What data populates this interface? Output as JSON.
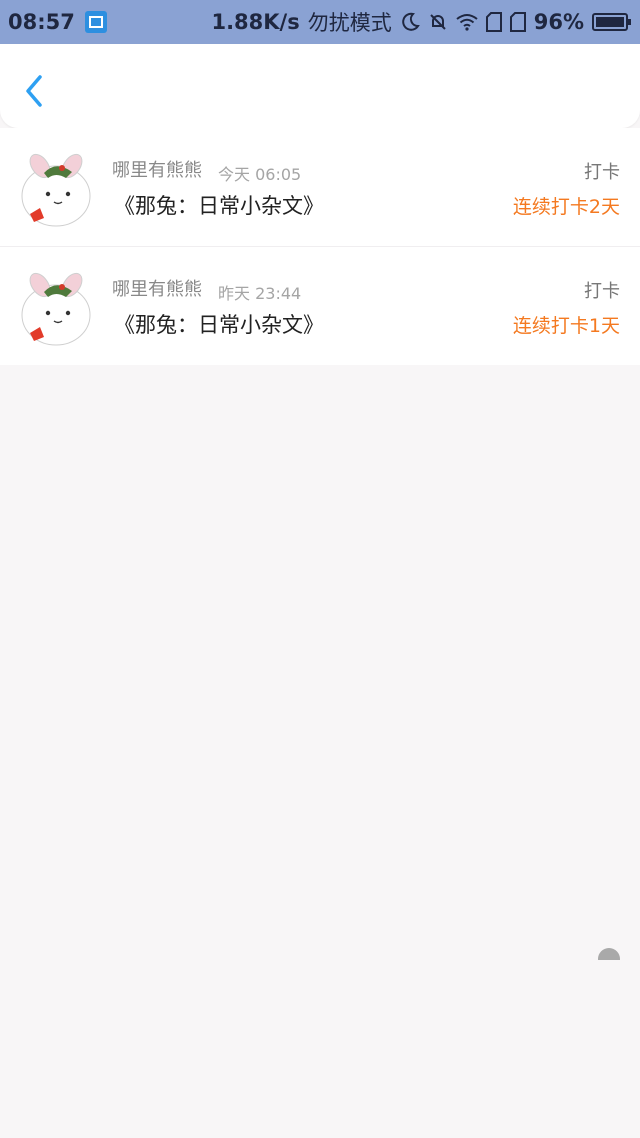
{
  "status_bar": {
    "time": "08:57",
    "network_speed": "1.88K/s",
    "mode": "勿扰模式",
    "battery": "96%",
    "icons": [
      "screen-record-icon",
      "moon-icon",
      "bell-off-icon",
      "wifi-icon",
      "sim-icon",
      "sim-icon",
      "battery-icon"
    ]
  },
  "nav": {
    "back_icon": "chevron-left-icon"
  },
  "records": [
    {
      "user": "哪里有熊熊",
      "time": "今天 06:05",
      "book": "《那兔：日常小杂文》",
      "type": "打卡",
      "streak": "连续打卡2天"
    },
    {
      "user": "哪里有熊熊",
      "time": "昨天 23:44",
      "book": "《那兔：日常小杂文》",
      "type": "打卡",
      "streak": "连续打卡1天"
    }
  ],
  "colors": {
    "status_bar": "#8aa2d3",
    "accent": "#2ea0f2",
    "streak": "#f47920"
  }
}
